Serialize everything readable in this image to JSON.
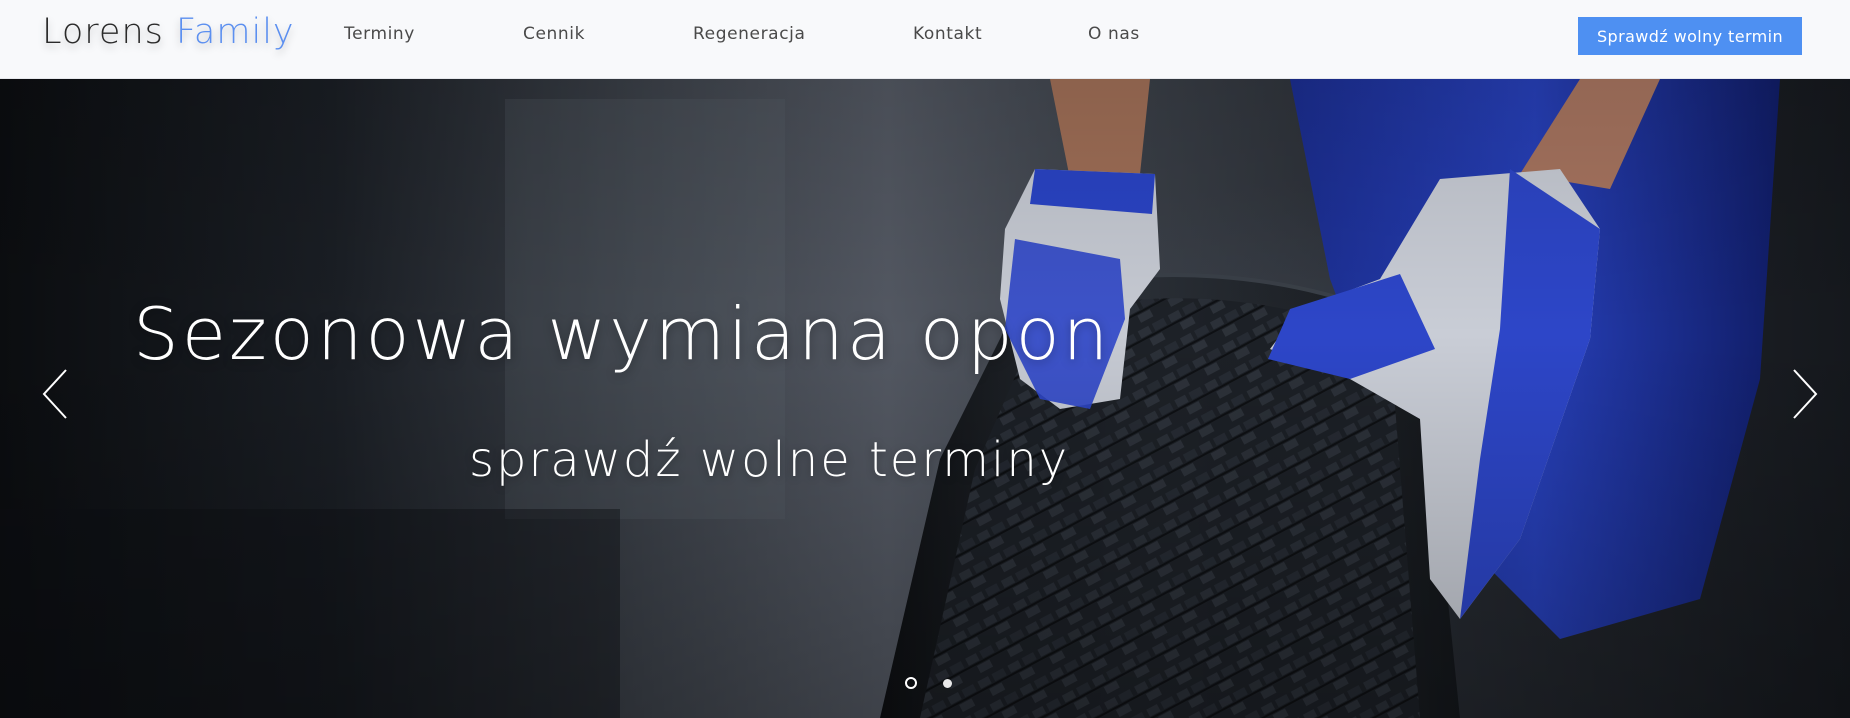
{
  "header": {
    "logo": {
      "primary": "Lorens",
      "accent": "Family"
    },
    "nav": [
      {
        "label": "Terminy"
      },
      {
        "label": "Cennik"
      },
      {
        "label": "Regeneracja"
      },
      {
        "label": "Kontakt"
      },
      {
        "label": "O nas"
      }
    ],
    "cta_label": "Sprawdź wolny termin"
  },
  "hero": {
    "title": "Sezonowa wymiana opon",
    "subtitle": "sprawdź wolne terminy",
    "slides": {
      "count": 2,
      "active_index": 1
    }
  },
  "colors": {
    "accent": "#4e90f2",
    "logo_accent": "#5b8ff0",
    "glove_blue": "#2d46c8",
    "glove_grey": "#c9cdd6",
    "overalls_blue": "#1f35a8",
    "tire": "#1d2126"
  },
  "icons": {
    "prev": "chevron-left-icon",
    "next": "chevron-right-icon"
  }
}
